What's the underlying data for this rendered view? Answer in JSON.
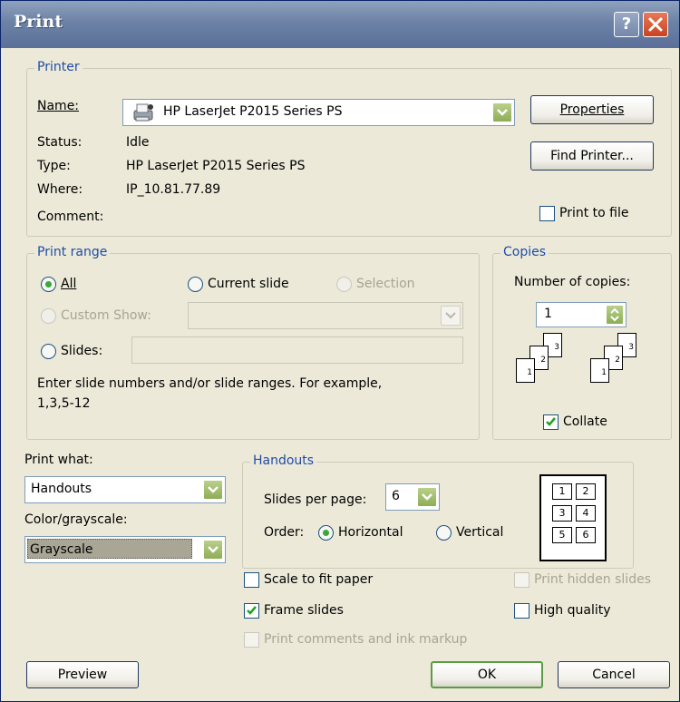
{
  "window": {
    "title": "Print"
  },
  "printer": {
    "legend": "Printer",
    "name_label": "Name:",
    "name_value": "HP LaserJet P2015 Series PS",
    "status_label": "Status:",
    "status_value": "Idle",
    "type_label": "Type:",
    "type_value": "HP LaserJet P2015 Series PS",
    "where_label": "Where:",
    "where_value": "IP_10.81.77.89",
    "comment_label": "Comment:",
    "properties_button": "Properties",
    "find_printer_button": "Find Printer...",
    "print_to_file": "Print to file",
    "print_to_file_checked": false
  },
  "print_range": {
    "legend": "Print range",
    "all": "All",
    "current_slide": "Current slide",
    "selection": "Selection",
    "custom_show": "Custom Show:",
    "slides": "Slides:",
    "help_text_line1": "Enter slide numbers and/or slide ranges. For example,",
    "help_text_line2": "1,3,5-12",
    "selected": "All"
  },
  "copies": {
    "legend": "Copies",
    "number_label": "Number of copies:",
    "number_value": "1",
    "collate": "Collate",
    "collate_checked": true,
    "stack_a": [
      "1",
      "2",
      "3"
    ],
    "stack_b": [
      "1",
      "2",
      "3"
    ]
  },
  "print_what": {
    "label": "Print what:",
    "value": "Handouts"
  },
  "color": {
    "label": "Color/grayscale:",
    "value": "Grayscale"
  },
  "handouts": {
    "legend": "Handouts",
    "slides_per_page_label": "Slides per page:",
    "slides_per_page_value": "6",
    "order_label": "Order:",
    "horizontal": "Horizontal",
    "vertical": "Vertical",
    "order_selected": "Horizontal",
    "preview_numbers": [
      "1",
      "2",
      "3",
      "4",
      "5",
      "6"
    ]
  },
  "options": {
    "scale_to_fit": "Scale to fit paper",
    "frame_slides": "Frame slides",
    "print_comments": "Print comments and ink markup",
    "print_hidden": "Print hidden slides",
    "high_quality": "High quality",
    "scale_checked": false,
    "frame_checked": true,
    "high_quality_checked": false
  },
  "buttons": {
    "preview": "Preview",
    "ok": "OK",
    "cancel": "Cancel"
  }
}
